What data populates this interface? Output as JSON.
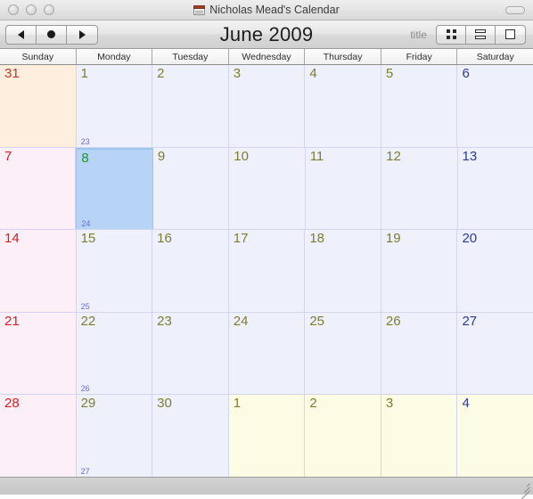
{
  "window": {
    "title": "Nicholas Mead's Calendar",
    "doc_icon": "calendar-document-icon",
    "close_label": "",
    "minimize_label": "",
    "zoom_label": ""
  },
  "toolbar": {
    "prev_label": "◀",
    "today_label": "●",
    "next_label": "▶",
    "month_title": "June 2009",
    "title_label": "title",
    "view_month_label": "",
    "view_week_label": "",
    "view_day_label": ""
  },
  "weekdays": [
    "Sunday",
    "Monday",
    "Tuesday",
    "Wednesday",
    "Thursday",
    "Friday",
    "Saturday"
  ],
  "colors": {
    "sunday_bg": "#fdeff8",
    "weekday_bg": "#eef0fb",
    "prev_month_bg": "#fdeede",
    "next_month_bg": "#fcfce4",
    "selected_bg": "#b7d4f7",
    "sunday_text": "#d12020",
    "saturday_text": "#2e3a96",
    "weekday_text": "#7d7d32",
    "today_text": "#1c9431",
    "week_number_text": "#6c6ce0",
    "grid_line": "#d2d5ef"
  },
  "weeks": [
    {
      "week_number": "23",
      "days": [
        {
          "num": "31",
          "kind": "other-prev",
          "color": "brown",
          "selected": false
        },
        {
          "num": "1",
          "kind": "weekday",
          "color": "olive",
          "selected": false
        },
        {
          "num": "2",
          "kind": "weekday",
          "color": "olive",
          "selected": false
        },
        {
          "num": "3",
          "kind": "weekday",
          "color": "olive",
          "selected": false
        },
        {
          "num": "4",
          "kind": "weekday",
          "color": "olive",
          "selected": false
        },
        {
          "num": "5",
          "kind": "weekday",
          "color": "olive",
          "selected": false
        },
        {
          "num": "6",
          "kind": "saturday",
          "color": "navy",
          "selected": false
        }
      ]
    },
    {
      "week_number": "24",
      "days": [
        {
          "num": "7",
          "kind": "sunday",
          "color": "red",
          "selected": false
        },
        {
          "num": "8",
          "kind": "weekday",
          "color": "green",
          "selected": true
        },
        {
          "num": "9",
          "kind": "weekday",
          "color": "olive",
          "selected": false
        },
        {
          "num": "10",
          "kind": "weekday",
          "color": "olive",
          "selected": false
        },
        {
          "num": "11",
          "kind": "weekday",
          "color": "olive",
          "selected": false
        },
        {
          "num": "12",
          "kind": "weekday",
          "color": "olive",
          "selected": false
        },
        {
          "num": "13",
          "kind": "saturday",
          "color": "navy",
          "selected": false
        }
      ]
    },
    {
      "week_number": "25",
      "days": [
        {
          "num": "14",
          "kind": "sunday",
          "color": "red",
          "selected": false
        },
        {
          "num": "15",
          "kind": "weekday",
          "color": "olive",
          "selected": false
        },
        {
          "num": "16",
          "kind": "weekday",
          "color": "olive",
          "selected": false
        },
        {
          "num": "17",
          "kind": "weekday",
          "color": "olive",
          "selected": false
        },
        {
          "num": "18",
          "kind": "weekday",
          "color": "olive",
          "selected": false
        },
        {
          "num": "19",
          "kind": "weekday",
          "color": "olive",
          "selected": false
        },
        {
          "num": "20",
          "kind": "saturday",
          "color": "navy",
          "selected": false
        }
      ]
    },
    {
      "week_number": "26",
      "days": [
        {
          "num": "21",
          "kind": "sunday",
          "color": "red",
          "selected": false
        },
        {
          "num": "22",
          "kind": "weekday",
          "color": "olive",
          "selected": false
        },
        {
          "num": "23",
          "kind": "weekday",
          "color": "olive",
          "selected": false
        },
        {
          "num": "24",
          "kind": "weekday",
          "color": "olive",
          "selected": false
        },
        {
          "num": "25",
          "kind": "weekday",
          "color": "olive",
          "selected": false
        },
        {
          "num": "26",
          "kind": "weekday",
          "color": "olive",
          "selected": false
        },
        {
          "num": "27",
          "kind": "saturday",
          "color": "navy",
          "selected": false
        }
      ]
    },
    {
      "week_number": "27",
      "days": [
        {
          "num": "28",
          "kind": "sunday",
          "color": "red",
          "selected": false
        },
        {
          "num": "29",
          "kind": "weekday",
          "color": "olive",
          "selected": false
        },
        {
          "num": "30",
          "kind": "weekday",
          "color": "olive",
          "selected": false
        },
        {
          "num": "1",
          "kind": "other-next",
          "color": "olive",
          "selected": false
        },
        {
          "num": "2",
          "kind": "other-next",
          "color": "olive",
          "selected": false
        },
        {
          "num": "3",
          "kind": "other-next",
          "color": "olive",
          "selected": false
        },
        {
          "num": "4",
          "kind": "other-next",
          "color": "navy",
          "selected": false
        }
      ]
    }
  ]
}
